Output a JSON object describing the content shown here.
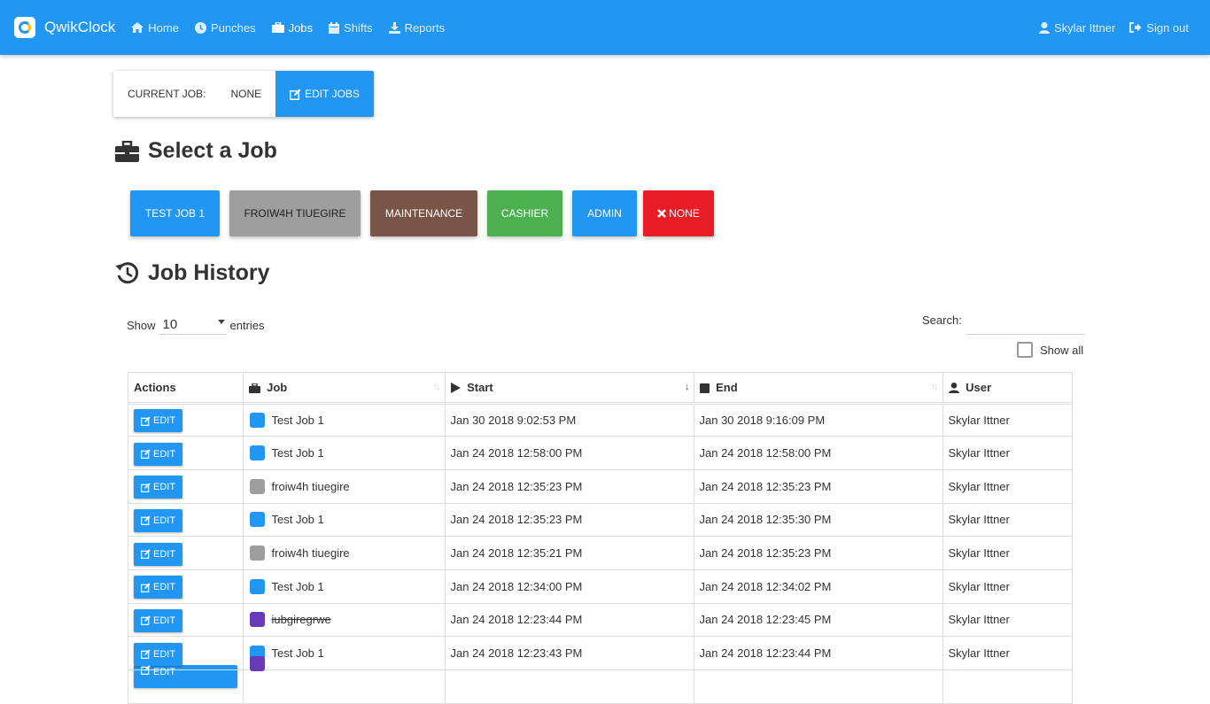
{
  "app": {
    "title": "QwikClock"
  },
  "nav": {
    "items": [
      {
        "label": "Home",
        "icon": "home-icon"
      },
      {
        "label": "Punches",
        "icon": "clock-icon"
      },
      {
        "label": "Jobs",
        "icon": "briefcase-icon",
        "active": true
      },
      {
        "label": "Shifts",
        "icon": "calendar-icon"
      },
      {
        "label": "Reports",
        "icon": "download-icon"
      }
    ],
    "user": "Skylar Ittner",
    "signout": "Sign out"
  },
  "current_job": {
    "label": "CURRENT JOB:",
    "value": "NONE",
    "edit_label": "EDIT JOBS"
  },
  "select_job": {
    "title": "Select a Job",
    "buttons": [
      {
        "label": "TEST JOB 1",
        "color": "#2196f3",
        "text_color": "#ffffff"
      },
      {
        "label": "FROIW4H TIUEGIRE",
        "color": "#9e9e9e",
        "text_color": "#222222"
      },
      {
        "label": "MAINTENANCE",
        "color": "#795548",
        "text_color": "#ffffff"
      },
      {
        "label": "CASHIER",
        "color": "#4caf50",
        "text_color": "#ffffff"
      },
      {
        "label": "ADMIN",
        "color": "#2196f3",
        "text_color": "#ffffff"
      },
      {
        "label": "NONE",
        "color": "#e81d25",
        "text_color": "#ffffff"
      }
    ]
  },
  "history": {
    "title": "Job History",
    "show_label": "Show",
    "entries_value": "10",
    "entries_label": "entries",
    "search_label": "Search:",
    "show_all_label": "Show all",
    "columns": [
      "Actions",
      "Job",
      "Start",
      "End",
      "User"
    ],
    "edit_label": "EDIT",
    "rows": [
      {
        "job": "Test Job 1",
        "color": "#2196f3",
        "start": "Jan 30 2018 9:02:53 PM",
        "end": "Jan 30 2018 9:16:09 PM",
        "user": "Skylar Ittner"
      },
      {
        "job": "Test Job 1",
        "color": "#2196f3",
        "start": "Jan 24 2018 12:58:00 PM",
        "end": "Jan 24 2018 12:58:00 PM",
        "user": "Skylar Ittner"
      },
      {
        "job": "froiw4h tiuegire",
        "color": "#9e9e9e",
        "start": "Jan 24 2018 12:35:23 PM",
        "end": "Jan 24 2018 12:35:23 PM",
        "user": "Skylar Ittner"
      },
      {
        "job": "Test Job 1",
        "color": "#2196f3",
        "start": "Jan 24 2018 12:35:23 PM",
        "end": "Jan 24 2018 12:35:30 PM",
        "user": "Skylar Ittner"
      },
      {
        "job": "froiw4h tiuegire",
        "color": "#9e9e9e",
        "start": "Jan 24 2018 12:35:21 PM",
        "end": "Jan 24 2018 12:35:23 PM",
        "user": "Skylar Ittner"
      },
      {
        "job": "Test Job 1",
        "color": "#2196f3",
        "start": "Jan 24 2018 12:34:00 PM",
        "end": "Jan 24 2018 12:34:02 PM",
        "user": "Skylar Ittner"
      },
      {
        "job": "iubgiregrwe",
        "color": "#673ab7",
        "strike": true,
        "start": "Jan 24 2018 12:23:44 PM",
        "end": "Jan 24 2018 12:23:45 PM",
        "user": "Skylar Ittner"
      },
      {
        "job": "Test Job 1",
        "color": "#2196f3",
        "start": "Jan 24 2018 12:23:43 PM",
        "end": "Jan 24 2018 12:23:44 PM",
        "user": "Skylar Ittner"
      },
      {
        "job": "",
        "color": "#673ab7",
        "start": "",
        "end": "",
        "user": ""
      }
    ]
  }
}
